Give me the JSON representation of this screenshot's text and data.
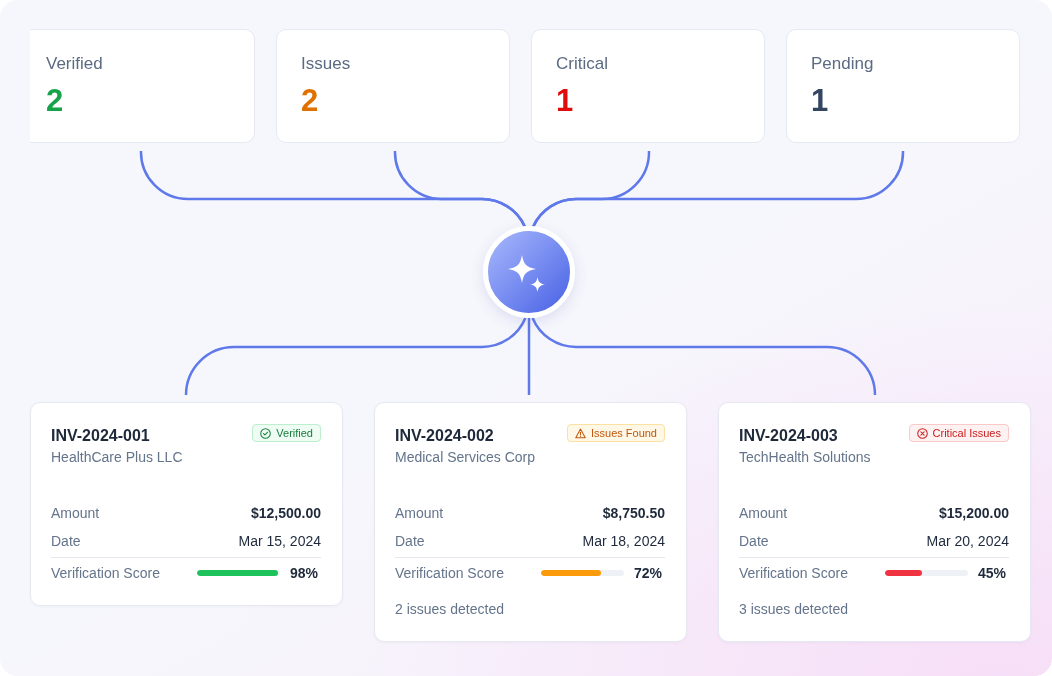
{
  "stats": [
    {
      "label": "Verified",
      "value": "2",
      "color": "#16a34a"
    },
    {
      "label": "Issues",
      "value": "2",
      "color": "#e07000"
    },
    {
      "label": "Critical",
      "value": "1",
      "color": "#e00b0b"
    },
    {
      "label": "Pending",
      "value": "1",
      "color": "#334561"
    }
  ],
  "invoices": [
    {
      "number": "INV-2024-001",
      "company": "HealthCare Plus LLC",
      "badge": {
        "label": "Verified",
        "kind": "verified"
      },
      "details": [
        {
          "label": "Amount",
          "value": "$12,500.00",
          "strong": true
        },
        {
          "label": "Date",
          "value": "Mar 15, 2024",
          "strong": false
        }
      ],
      "score": {
        "label": "Verification Score",
        "level": 0.98,
        "reading": "98%"
      }
    },
    {
      "number": "INV-2024-002",
      "company": "Medical Services Corp",
      "badge": {
        "label": "Issues Found",
        "kind": "issues"
      },
      "details": [
        {
          "label": "Amount",
          "value": "$8,750.50",
          "strong": true
        },
        {
          "label": "Date",
          "value": "Mar 18, 2024",
          "strong": false
        }
      ],
      "score": {
        "label": "Verification Score",
        "level": 0.72,
        "reading": "72%"
      },
      "note": "2 issues detected"
    },
    {
      "number": "INV-2024-003",
      "company": "TechHealth Solutions",
      "badge": {
        "label": "Critical Issues",
        "kind": "critical"
      },
      "details": [
        {
          "label": "Amount",
          "value": "$15,200.00",
          "strong": true
        },
        {
          "label": "Date",
          "value": "Mar 20, 2024",
          "strong": false
        }
      ],
      "score": {
        "label": "Verification Score",
        "level": 0.45,
        "reading": "45%"
      },
      "note": "3 issues detected"
    }
  ]
}
